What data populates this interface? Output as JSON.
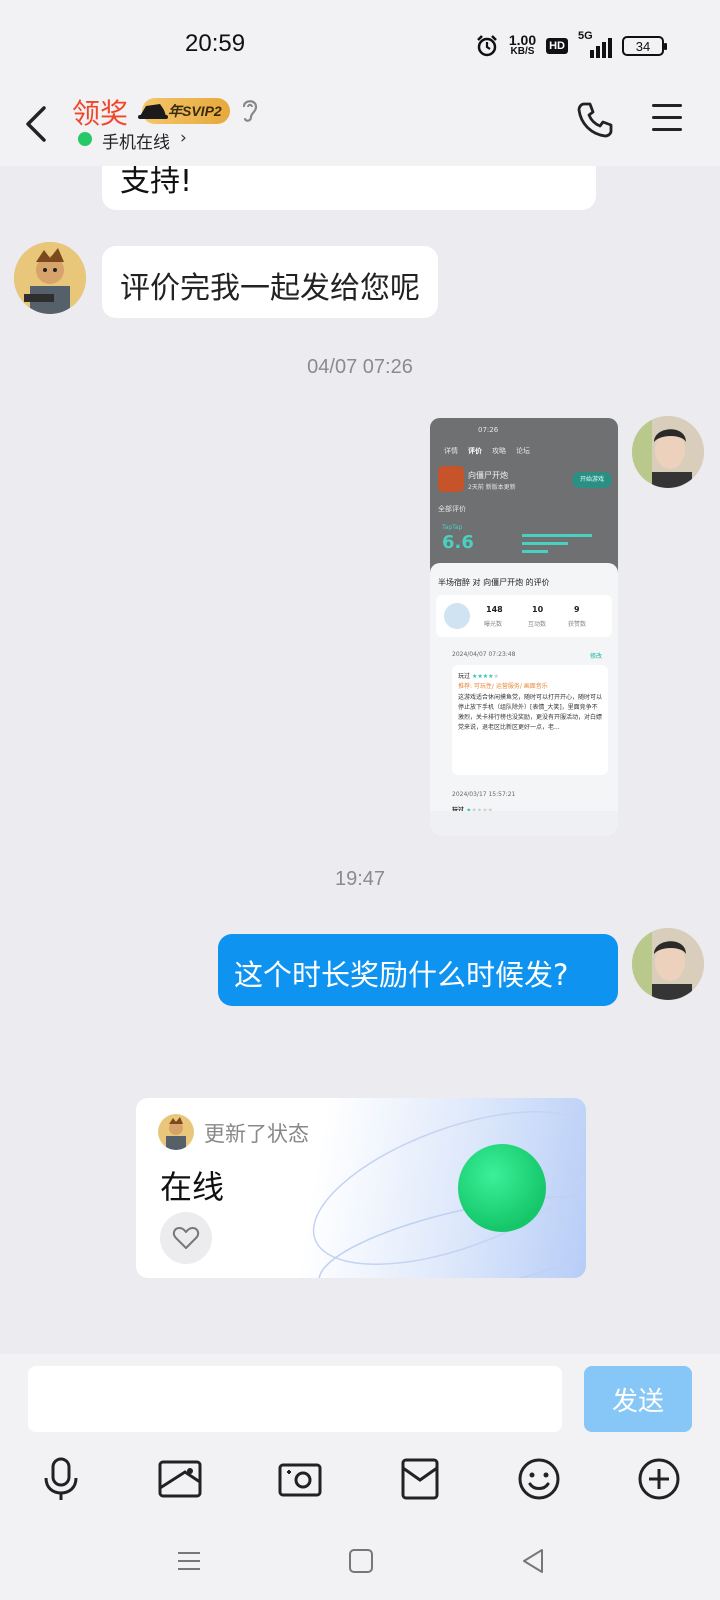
{
  "status_bar": {
    "time": "20:59",
    "net_speed_value": "1.00",
    "net_speed_unit": "KB/S",
    "hd": "HD",
    "network": "5G",
    "battery": "34"
  },
  "header": {
    "name": "领奖",
    "svip": "年SVIP2",
    "online_status": "手机在线",
    "online_chevron": "›"
  },
  "messages": {
    "partial_top": "支持!",
    "received_1": "评价完我一起发给您呢",
    "timestamp_1": "04/07 07:26",
    "timestamp_2": "19:47",
    "sent_text": "这个时长奖励什么时候发?"
  },
  "screenshot": {
    "time": "07:26",
    "tabs": [
      "详情",
      "评价",
      "攻略",
      "论坛"
    ],
    "game_name": "向僵尸开炮",
    "game_sub": "2天前 新版本更新",
    "open_btn": "开始游戏",
    "all_reviews": "全部评价",
    "taptap": "TapTap",
    "score": "6.6",
    "panel_title": "半场宿醉 对 向僵尸开炮 的评价",
    "stats": [
      {
        "value": "148",
        "label": "曝光数"
      },
      {
        "value": "10",
        "label": "互动数"
      },
      {
        "value": "9",
        "label": "获赞数"
      }
    ],
    "review_date": "2024/04/07 07:23:48",
    "review_edit": "修改",
    "review_label": "玩过",
    "review_tags": "推荐: 可玩性/ 运营服务/ 画面音乐",
    "review_text": "这游戏适合休闲摸鱼党，随时可以打开开心，随时可以停止放下手机（组队除外）[表情_大笑]，里面竞争不激烈，关卡排行榜也没奖励，更没有开服活动，对白嫖党来说，退老区比新区更好一点，老...",
    "older_date": "2024/03/17 15:57:21",
    "older_label": "玩过"
  },
  "status_card": {
    "updated": "更新了状态",
    "state": "在线"
  },
  "input": {
    "placeholder": "",
    "send": "发送"
  },
  "toolbar_icons": [
    "microphone-icon",
    "image-icon",
    "camera-icon",
    "red-packet-icon",
    "emoji-icon",
    "plus-icon"
  ],
  "colors": {
    "accent": "#0f93f0",
    "name": "#f0472a",
    "online": "#27c866"
  }
}
